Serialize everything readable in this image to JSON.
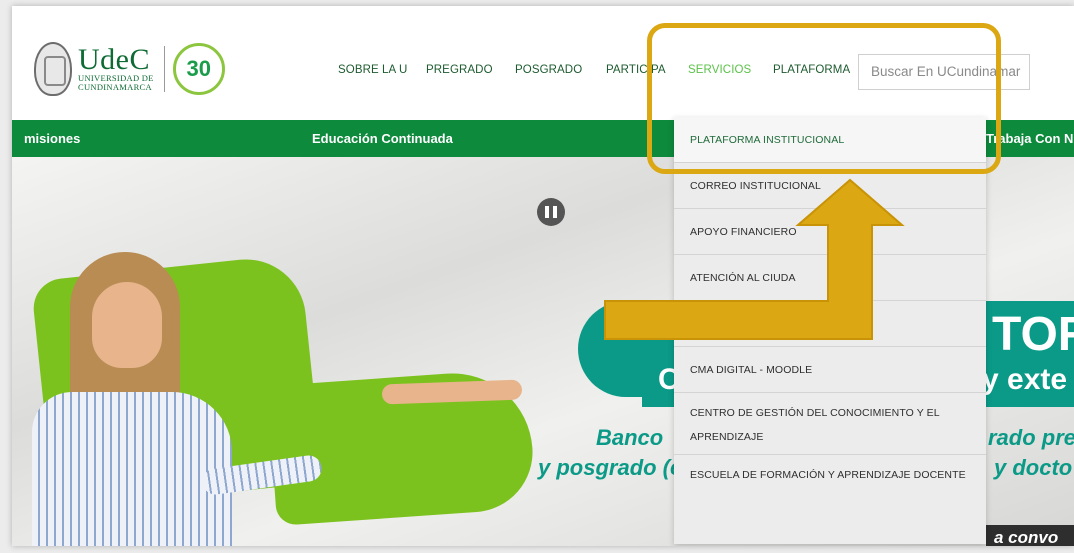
{
  "header": {
    "logo": {
      "name": "UdeC",
      "subtitle_line1": "UNIVERSIDAD DE",
      "subtitle_line2": "CUNDINAMARCA",
      "badge": "30"
    },
    "nav": [
      {
        "label": "SOBRE LA U"
      },
      {
        "label": "PREGRADO"
      },
      {
        "label": "POSGRADO"
      },
      {
        "label": "PARTICIPA"
      },
      {
        "label": "SERVICIOS",
        "active": true
      },
      {
        "label": "PLATAFORMA"
      }
    ],
    "search": {
      "placeholder": "Buscar En UCundinamar"
    }
  },
  "greenbar": {
    "items": [
      {
        "label": "misiones"
      },
      {
        "label": "Educación Continuada"
      },
      {
        "label": "Trabaja Con N"
      }
    ]
  },
  "hero": {
    "texts": {
      "tor": "TOR",
      "c": "C",
      "exte": "y exte",
      "banco": "Banco",
      "posgrado": "y posgrado (e",
      "rado": "rado pre",
      "ydocto": "y docto",
      "convo": "a convo"
    }
  },
  "dropdown": {
    "items": [
      {
        "label": "PLATAFORMA INSTITUCIONAL"
      },
      {
        "label": "CORREO INSTITUCIONAL"
      },
      {
        "label": "APOYO FINANCIERO"
      },
      {
        "label": "ATENCIÓN AL CIUDA"
      },
      {
        "label": ""
      },
      {
        "label": "CMA DIGITAL - MOODLE"
      },
      {
        "label": "CENTRO DE GESTIÓN DEL CONOCIMIENTO Y EL APRENDIZAJE"
      },
      {
        "label": "ESCUELA DE FORMACIÓN Y APRENDIZAJE DOCENTE"
      }
    ]
  },
  "colors": {
    "brand_green": "#0d8a3c",
    "active_nav": "#5cc24a",
    "highlight": "#dba712",
    "teal": "#0a9a87"
  }
}
